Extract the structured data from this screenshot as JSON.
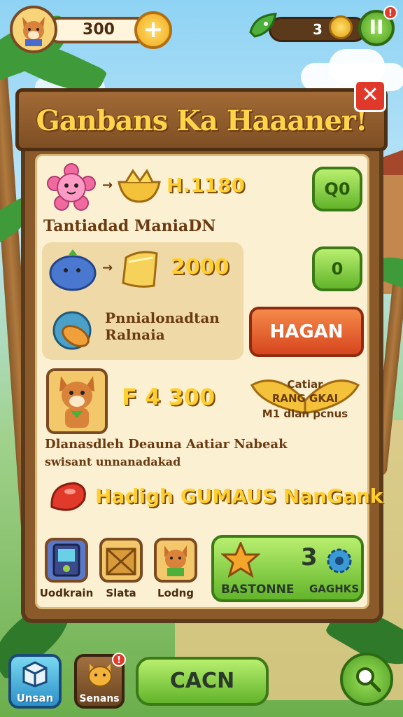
{
  "hud": {
    "coins": "300",
    "plus_label": "+",
    "resource_count": "3",
    "pause_label": "II",
    "pause_badge": "!"
  },
  "dialog": {
    "title": "Ganbans Ka Haaaner!",
    "close_label": "✕",
    "row1": {
      "amount": "H.1180",
      "button": "Q0",
      "label": "Tantiadad ManiaDN"
    },
    "row2": {
      "amount": "2000",
      "button": "0",
      "label_line1": "Pnnialonadtan",
      "label_line2": "Ralnaia",
      "action_button": "HAGAN"
    },
    "row3": {
      "amount": "F 4 300",
      "bonus_line1": "Catiar",
      "bonus_line2": "RANG GKAI",
      "bonus_line3": "M1 dlan pcnus"
    },
    "description_line1": "Dlanasdleh Deauna Aatiar Nabeak",
    "description_line2": "swisant unnanadakad",
    "highlight": "Hadigh GUMAUS NanGank",
    "slots": [
      {
        "label": "Uodkrain",
        "icon": "device-icon"
      },
      {
        "label": "Slata",
        "icon": "crate-icon"
      },
      {
        "label": "Lodng",
        "icon": "fox-icon"
      }
    ],
    "combo_panel": {
      "count": "3",
      "left_label": "BASTONNE",
      "right_label": "GAGHKS"
    }
  },
  "bottom_bar": {
    "left_label": "Unsan",
    "middle_left_label": "Senans",
    "middle_left_badge": "!",
    "main_button": "CACN"
  },
  "colors": {
    "wood": "#8a5a2b",
    "parchment": "#fbf0d2",
    "green_button": "#62b42a",
    "orange_button": "#d6451e",
    "gold_text": "#ffcf2e"
  }
}
